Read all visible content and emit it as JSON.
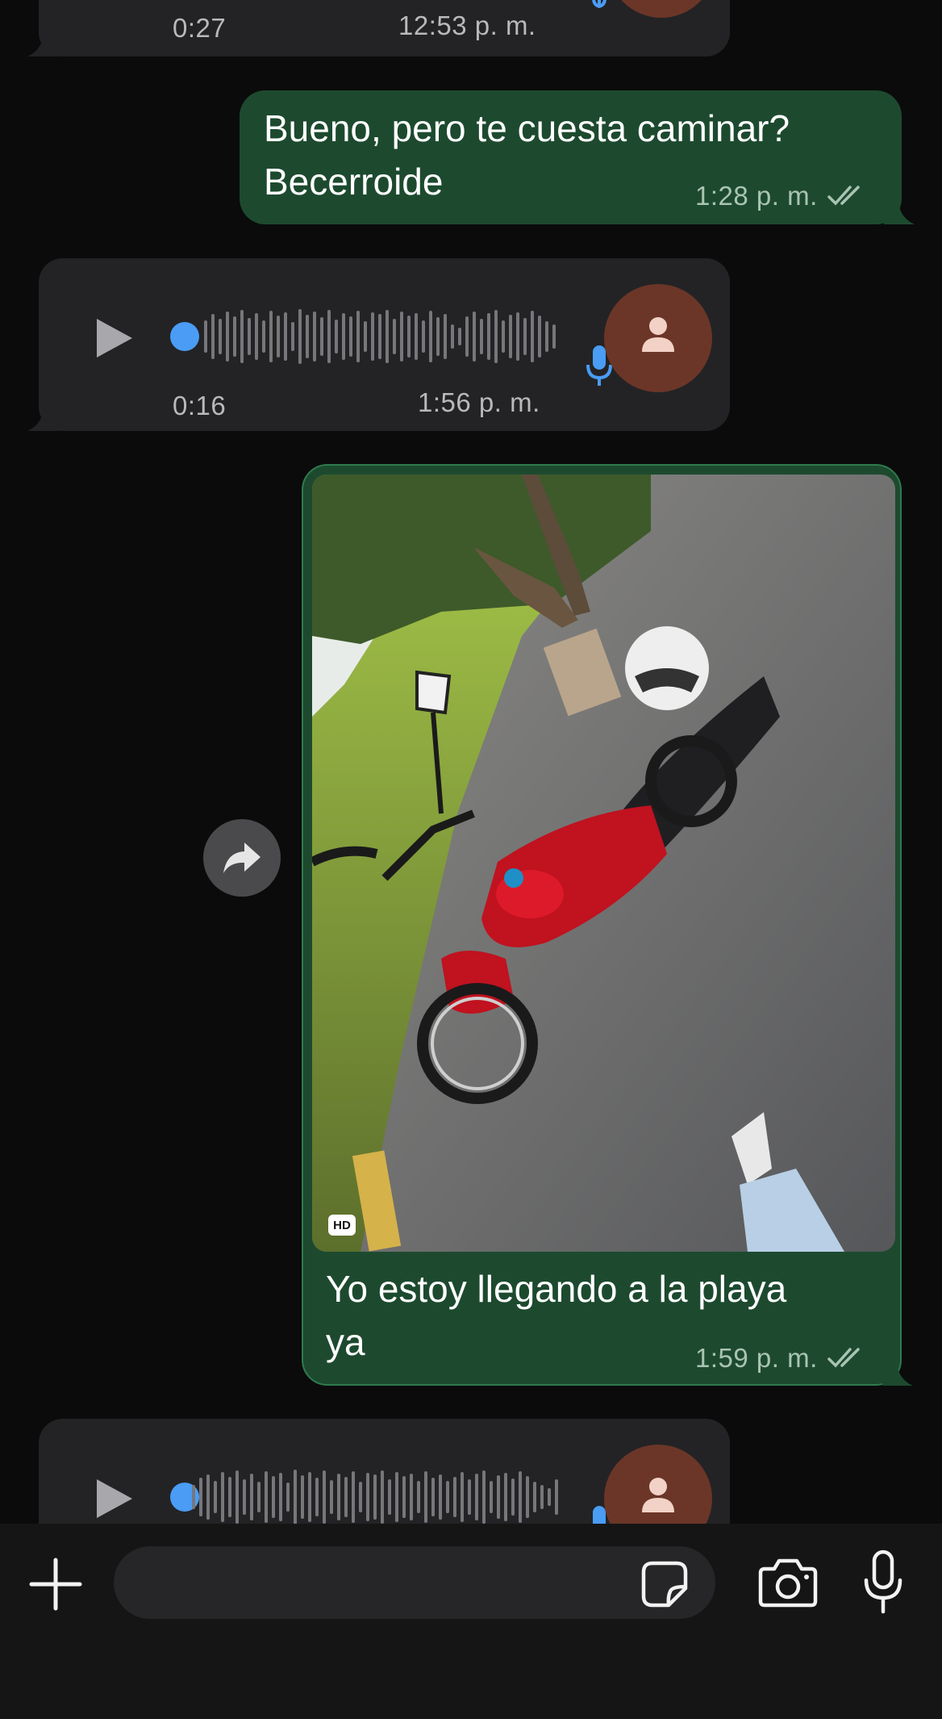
{
  "messages": {
    "top_voice": {
      "duration": "0:27",
      "time": "12:53 p. m."
    },
    "text_out": {
      "line1": "Bueno, pero te cuesta caminar?",
      "line2": "Becerroide",
      "time": "1:28 p. m."
    },
    "voice_in": {
      "duration": "0:16",
      "time": "1:56 p. m."
    },
    "photo_out": {
      "hd_badge": "HD",
      "caption_line1": "Yo estoy llegando a la playa",
      "caption_line2": "ya",
      "time": "1:59 p. m."
    }
  },
  "input_bar": {
    "icons": [
      "plus-icon",
      "sticker-icon",
      "camera-icon",
      "microphone-icon"
    ]
  },
  "colors": {
    "background": "#0b0b0b",
    "incoming_bubble": "#232325",
    "outgoing_bubble": "#1d4a2f",
    "accent_blue": "#4a9cf5",
    "avatar": "#6b3628"
  }
}
